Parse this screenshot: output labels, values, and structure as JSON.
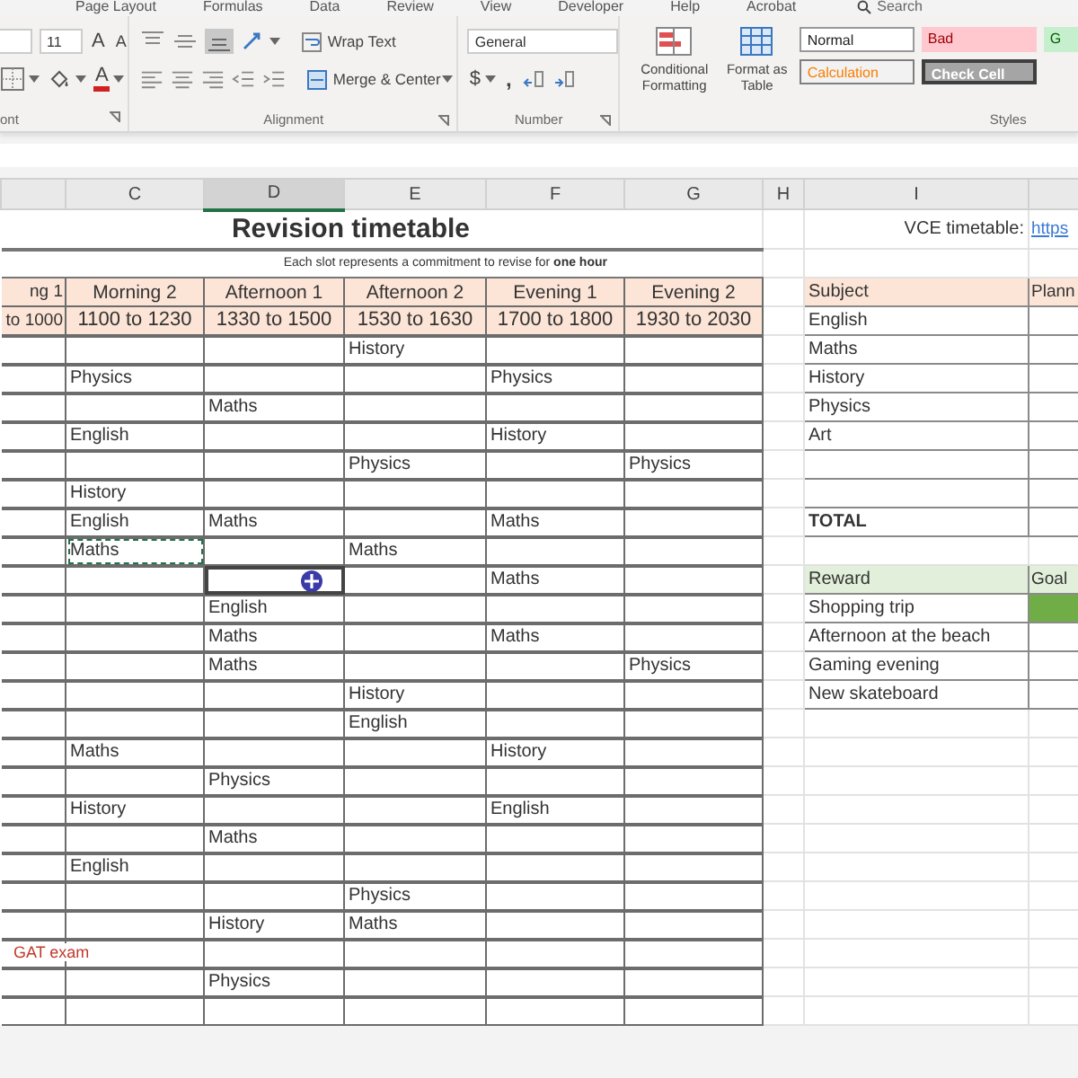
{
  "menu_tabs": [
    "Page Layout",
    "Formulas",
    "Data",
    "Review",
    "View",
    "Developer",
    "Help",
    "Acrobat"
  ],
  "search": {
    "placeholder": "Search"
  },
  "ribbon": {
    "font": {
      "size": "11",
      "grow_font": "A",
      "shrink_font": "A",
      "font_color": "A",
      "label": "ont"
    },
    "alignment": {
      "wrap_text": "Wrap Text",
      "merge_center": "Merge & Center",
      "label": "Alignment"
    },
    "number": {
      "format": "General",
      "currency": "$",
      "comma": ",",
      "label": "Number"
    },
    "styles": {
      "conditional_formatting": "Conditional Formatting",
      "format_as_table": "Format as Table",
      "label": "Styles",
      "gallery": [
        {
          "label": "Normal",
          "kind": "normal"
        },
        {
          "label": "Bad",
          "kind": "bad"
        },
        {
          "label": "G",
          "kind": "good"
        },
        {
          "label": "Calculation",
          "kind": "calculation"
        },
        {
          "label": "Check Cell",
          "kind": "check"
        }
      ]
    }
  },
  "column_headers": [
    {
      "label": "C",
      "selected": false
    },
    {
      "label": "D",
      "selected": true
    },
    {
      "label": "E",
      "selected": false
    },
    {
      "label": "F",
      "selected": false
    },
    {
      "label": "G",
      "selected": false
    },
    {
      "label": "H",
      "selected": false
    },
    {
      "label": "I",
      "selected": false
    }
  ],
  "timetable": {
    "title": "Revision timetable",
    "subtitle": "Each slot represents a commitment to revise for **one hour**",
    "slots": [
      "ng 1",
      "Morning 2",
      "Afternoon 1",
      "Afternoon 2",
      "Evening 1",
      "Evening 2"
    ],
    "times": [
      "to 1000",
      "1100 to 1230",
      "1330 to 1500",
      "1530 to 1630",
      "1700 to 1800",
      "1930 to 2030"
    ],
    "rows": [
      {
        "E": "History"
      },
      {
        "C": "Physics",
        "F": "Physics"
      },
      {
        "D": "Maths"
      },
      {
        "C": "English",
        "F": "History"
      },
      {
        "E": "Physics",
        "G": "Physics"
      },
      {
        "C": "History"
      },
      {
        "C": "English",
        "D": "Maths",
        "F": "Maths"
      },
      {
        "C": {
          "text": "Maths",
          "copied": true
        },
        "E": "Maths"
      },
      {
        "D": {
          "active": true
        },
        "F": "Maths"
      },
      {
        "D": "English"
      },
      {
        "D": "Maths",
        "F": "Maths"
      },
      {
        "D": "Maths",
        "G": "Physics"
      },
      {
        "E": "History"
      },
      {
        "E": "English"
      },
      {
        "C": "Maths",
        "F": "History"
      },
      {
        "D": "Physics"
      },
      {
        "C": "History",
        "F": "English"
      },
      {
        "D": "Maths"
      },
      {
        "C": "English"
      },
      {
        "E": "Physics"
      },
      {
        "D": "History",
        "E": "Maths"
      },
      {
        "B": "GAT exam",
        "kind": "exam"
      },
      {
        "D": "Physics"
      },
      {}
    ]
  },
  "vce_link": {
    "label": "VCE timetable:",
    "link": "https"
  },
  "subject_table": {
    "columns": [
      "Subject",
      "Plann"
    ],
    "rows": [
      "English",
      "Maths",
      "History",
      "Physics",
      "Art"
    ],
    "total": "TOTAL"
  },
  "reward_table": {
    "columns": [
      "Reward",
      "Goal"
    ],
    "rows": [
      {
        "name": "Shopping trip",
        "achieved": true
      },
      {
        "name": "Afternoon at the beach",
        "achieved": false
      },
      {
        "name": "Gaming evening",
        "achieved": false
      },
      {
        "name": "New skateboard",
        "achieved": false
      }
    ]
  }
}
